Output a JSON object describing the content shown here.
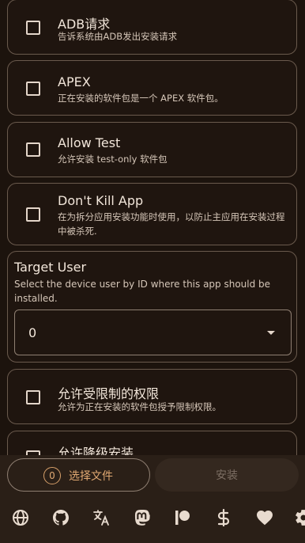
{
  "options": [
    {
      "title": "ADB请求",
      "description": "告诉系统由ADB发出安装请求",
      "checked": false
    },
    {
      "title": "APEX",
      "description": "正在安装的软件包是一个 APEX 软件包。",
      "checked": false
    },
    {
      "title": "Allow Test",
      "description": "允许安装 test-only 软件包",
      "checked": false
    },
    {
      "title": "Don't Kill App",
      "description": "在为拆分应用安装功能时使用，以防止主应用在安装过程中被杀死.",
      "checked": false
    },
    {
      "title": "允许受限制的权限",
      "description": "允许为正在安装的软件包授予限制权限。",
      "checked": false
    },
    {
      "title": "允许降级安装",
      "description": "",
      "checked": false
    }
  ],
  "target_user": {
    "title": "Target User",
    "description": "Select the device user by ID where this app should be installed.",
    "selected_value": "0"
  },
  "actions": {
    "choose_count": "0",
    "choose_label": "选择文件",
    "install_label": "安装"
  },
  "bottom_icons": [
    "globe-icon",
    "github-icon",
    "translate-icon",
    "mastodon-icon",
    "patreon-icon",
    "dollar-icon",
    "heart-icon",
    "settings-icon"
  ],
  "colors": {
    "background": "#1c130d",
    "accent": "#e0a872",
    "bottom_bar": "#2a1f17"
  }
}
